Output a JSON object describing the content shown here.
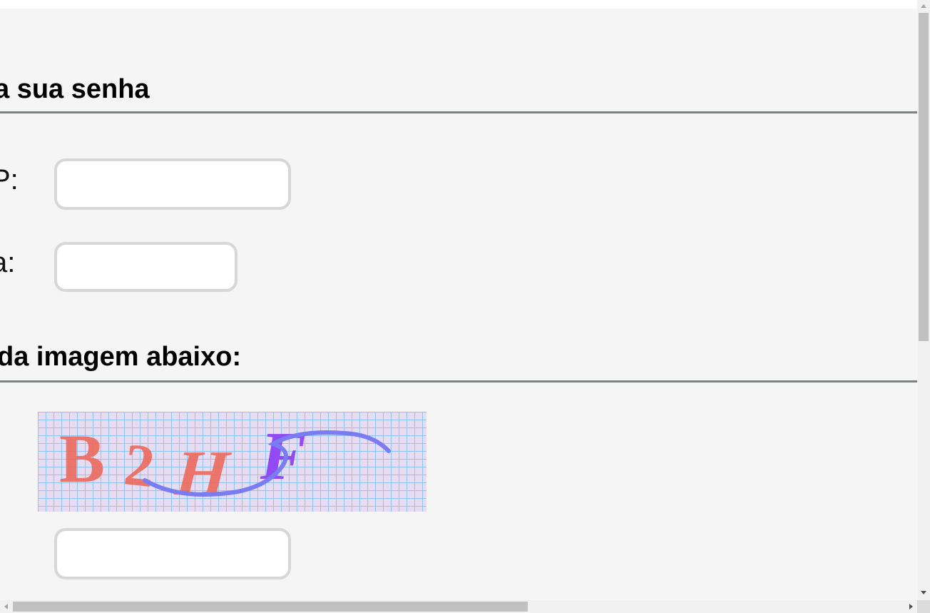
{
  "form": {
    "section1_title": "a sua senha",
    "field1_label": "P:",
    "field1_value": "",
    "field2_label": "a:",
    "field2_value": "",
    "section2_title": "da imagem abaixo:",
    "captcha_text": "B2HF",
    "captcha_input_value": ""
  },
  "colors": {
    "page_background": "#f5f5f5",
    "divider": "#7d8381",
    "input_border": "#d7d7d7",
    "captcha_background": "#e6ddf2",
    "captcha_grid": "#8ec3f5",
    "captcha_letters_red": "#ec6a5c",
    "captcha_letters_purple": "#8e44f5",
    "captcha_stroke": "#7a7cf2"
  },
  "icons": {
    "scroll_up": "chevron-up-icon",
    "scroll_down": "chevron-down-icon",
    "scroll_left": "chevron-left-icon",
    "scroll_right": "chevron-right-icon"
  }
}
